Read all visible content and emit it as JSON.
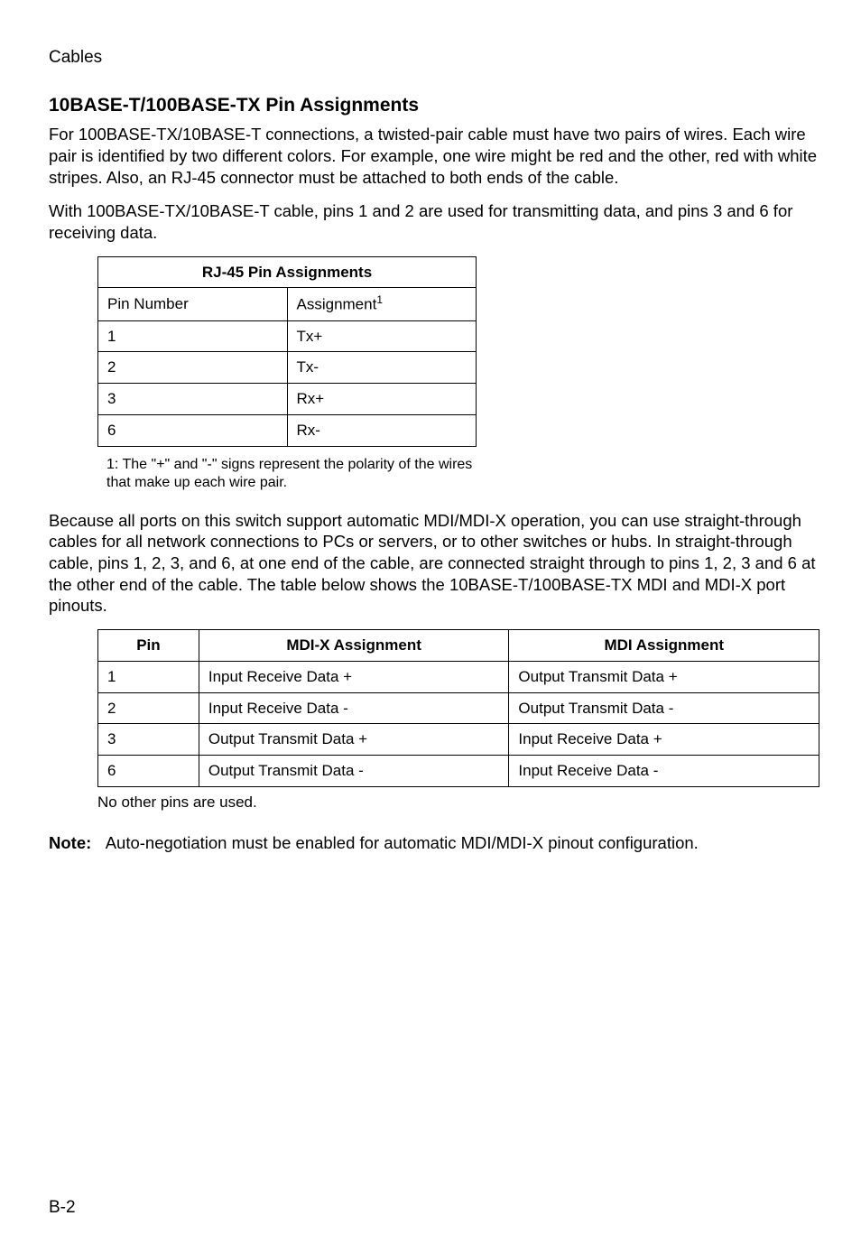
{
  "header": {
    "section": "Cables"
  },
  "section": {
    "title": "10BASE-T/100BASE-TX Pin Assignments",
    "para1": "For 100BASE-TX/10BASE-T connections, a twisted-pair cable must have two pairs of wires. Each wire pair is identified by two different colors. For example, one wire might be red and the other, red with white stripes. Also, an RJ-45 connector must be attached to both ends of the cable.",
    "para2": "With 100BASE-TX/10BASE-T cable, pins 1 and 2 are used for transmitting data, and pins 3 and 6 for receiving data."
  },
  "table1": {
    "caption": "RJ-45 Pin Assignments",
    "col1": "Pin Number",
    "col2_prefix": "Assignment",
    "col2_sup": "1",
    "rows": [
      {
        "pin": "1",
        "assign": "Tx+"
      },
      {
        "pin": "2",
        "assign": "Tx-"
      },
      {
        "pin": "3",
        "assign": "Rx+"
      },
      {
        "pin": "6",
        "assign": "Rx-"
      }
    ],
    "footnote": "1:  The \"+\" and \"-\" signs represent the polarity of the wires that make up each wire pair."
  },
  "para3": "Because all ports on this switch support automatic MDI/MDI-X operation, you can use straight-through cables for all network connections to PCs or servers, or to other switches or hubs. In straight-through cable, pins 1, 2, 3, and 6, at one end of the cable, are connected straight through to pins 1, 2, 3 and 6 at the other end of the cable. The table below shows the 10BASE-T/100BASE-TX MDI and MDI-X port pinouts.",
  "table2": {
    "col1": "Pin",
    "col2": "MDI-X Assignment",
    "col3": "MDI Assignment",
    "rows": [
      {
        "pin": "1",
        "mdix": "Input Receive Data +",
        "mdi": "Output Transmit Data +"
      },
      {
        "pin": "2",
        "mdix": "Input Receive Data -",
        "mdi": "Output Transmit Data -"
      },
      {
        "pin": "3",
        "mdix": "Output Transmit Data +",
        "mdi": "Input Receive Data +"
      },
      {
        "pin": "6",
        "mdix": "Output Transmit Data -",
        "mdi": "Input Receive Data -"
      }
    ],
    "footnote": "No other pins are used."
  },
  "note": {
    "label": "Note:",
    "text": "Auto-negotiation must be enabled for automatic MDI/MDI-X pinout configuration."
  },
  "footer": {
    "page": "B-2"
  },
  "chart_data": [
    {
      "type": "table",
      "title": "RJ-45 Pin Assignments",
      "columns": [
        "Pin Number",
        "Assignment"
      ],
      "rows": [
        [
          "1",
          "Tx+"
        ],
        [
          "2",
          "Tx-"
        ],
        [
          "3",
          "Rx+"
        ],
        [
          "6",
          "Rx-"
        ]
      ]
    },
    {
      "type": "table",
      "title": "10BASE-T/100BASE-TX MDI and MDI-X port pinouts",
      "columns": [
        "Pin",
        "MDI-X Assignment",
        "MDI Assignment"
      ],
      "rows": [
        [
          "1",
          "Input Receive Data +",
          "Output Transmit Data +"
        ],
        [
          "2",
          "Input Receive Data -",
          "Output Transmit Data -"
        ],
        [
          "3",
          "Output Transmit Data +",
          "Input Receive Data +"
        ],
        [
          "6",
          "Output Transmit Data -",
          "Input Receive Data -"
        ]
      ]
    }
  ]
}
